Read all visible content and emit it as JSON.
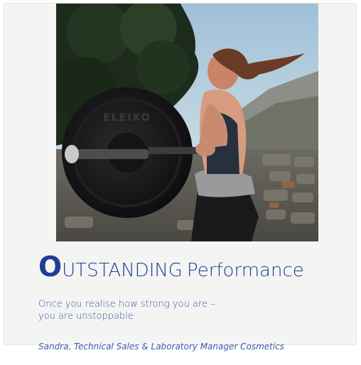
{
  "headline": {
    "first_letter": "O",
    "caps_rest": "UTSTANDING",
    "word": "Performance"
  },
  "quote": {
    "line1": "Once you realise how strong you are –",
    "line2": "you are unstoppable"
  },
  "author": "Sandra, Technical Sales & Laboratory Manager Cosmetics",
  "photo": {
    "plate_brand": "ELEIKO"
  },
  "colors": {
    "brand_blue": "#1f3e97",
    "text_blue": "#3d57a8",
    "card_bg": "#f4f4f2"
  }
}
